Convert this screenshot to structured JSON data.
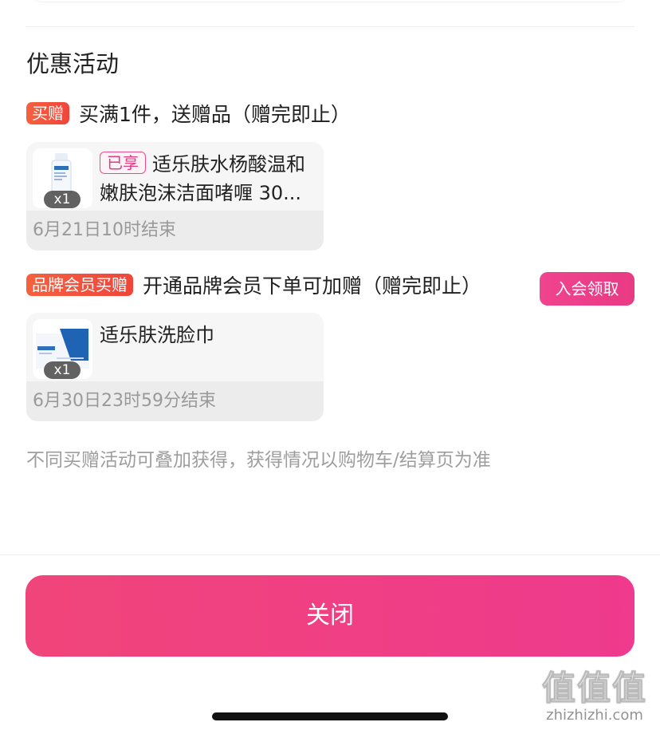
{
  "section_title": "优惠活动",
  "promotions": [
    {
      "tag": "买赠",
      "description": "买满1件，送赠品（赠完即止）",
      "gift": {
        "qty": "x1",
        "status_tag": "已享",
        "name": "适乐肤水杨酸温和嫩肤泡沫洁面啫喱 30...",
        "end_time": "6月21日10时结束"
      }
    },
    {
      "tag": "品牌会员买赠",
      "description": "开通品牌会员下单可加赠（赠完即止）",
      "action_label": "入会领取",
      "gift": {
        "qty": "x1",
        "name": "适乐肤洗脸巾",
        "end_time": "6月30日23时59分结束"
      }
    }
  ],
  "note": "不同买赠活动可叠加获得，获得情况以购物车/结算页为准",
  "close_label": "关闭",
  "watermark": {
    "big": "值值值",
    "small": "zhizhizhi.com"
  },
  "colors": {
    "accent_pink": "#ef3a8d",
    "promo_tag_orange": "#f0453a",
    "muted_text": "#9e9e9e"
  }
}
